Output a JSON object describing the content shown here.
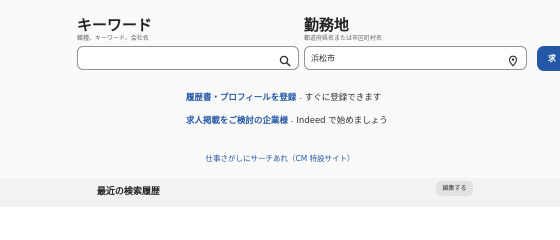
{
  "keyword": {
    "title": "キーワード",
    "subtitle": "職種、キーワード、会社名",
    "value": "",
    "icon": "search-icon"
  },
  "location": {
    "title": "勤務地",
    "subtitle": "都道府県名または市区町村名",
    "value": "浜松市",
    "icon": "location-pin-icon"
  },
  "find_button": {
    "label": "求"
  },
  "promos": [
    {
      "link": "履歴書・プロフィールを登録",
      "separator": "–",
      "text": "すぐに登録できます"
    },
    {
      "link": "求人掲載をご検討の企業様",
      "separator": "–",
      "text": "Indeed で始めましょう"
    }
  ],
  "cm_link": "仕事さがしにサーチあれ（CM 特設サイト）",
  "recent": {
    "title": "最近の検索履歴",
    "edit_label": "編集する"
  },
  "colors": {
    "accent": "#2557a7",
    "background": "#fafafa",
    "recent_bar": "#f3f2f1"
  }
}
